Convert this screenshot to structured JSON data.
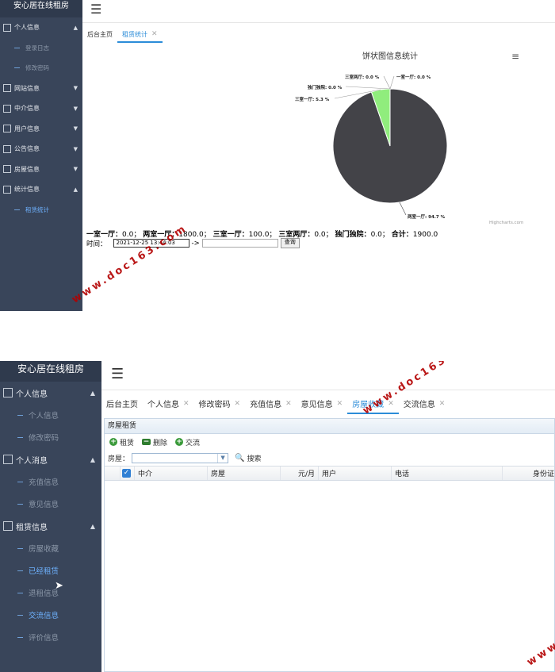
{
  "top": {
    "brand": "安心居在线租房",
    "menu": [
      {
        "label": "个人信息",
        "open": true,
        "subs": [
          {
            "label": "登录日志"
          },
          {
            "label": "修改密码"
          }
        ]
      },
      {
        "label": "网站信息"
      },
      {
        "label": "中介信息"
      },
      {
        "label": "用户信息"
      },
      {
        "label": "公告信息"
      },
      {
        "label": "房屋信息"
      },
      {
        "label": "统计信息",
        "open": true,
        "subs": [
          {
            "label": "租赁统计",
            "active": true
          }
        ]
      }
    ],
    "tabs": [
      {
        "label": "后台主页"
      },
      {
        "label": "租赁统计",
        "active": true
      }
    ],
    "summary": {
      "items": [
        {
          "label": "一室一厅：",
          "value": "0.0"
        },
        {
          "label": "两室一厅：",
          "value": "1800.0"
        },
        {
          "label": "三室一厅：",
          "value": "100.0"
        },
        {
          "label": "三室两厅：",
          "value": "0.0"
        },
        {
          "label": "独门独院：",
          "value": "0.0"
        }
      ],
      "total_label": "合计：",
      "total_value": "1900.0"
    },
    "time": {
      "label": "时间：",
      "start": "2021-12-25 13:44:03",
      "arrow": "->",
      "query_label": "查询"
    }
  },
  "chart_data": {
    "type": "pie",
    "title": "饼状图信息统计",
    "credits": "Highcharts.com",
    "slices": [
      {
        "name": "两室一厅",
        "value": 94.7,
        "label": "两室一厅: 94.7 %",
        "color": "#434348"
      },
      {
        "name": "三室一厅",
        "value": 5.3,
        "label": "三室一厅: 5.3 %",
        "color": "#90ed7d"
      },
      {
        "name": "独门独院",
        "value": 0.0,
        "label": "独门独院: 0.0 %",
        "color": "#f7a35c"
      },
      {
        "name": "三室两厅",
        "value": 0.0,
        "label": "三室两厅: 0.0 %",
        "color": "#8085e9"
      },
      {
        "name": "一室一厅",
        "value": 0.0,
        "label": "一室一厅: 0.0 %",
        "color": "#7cb5ec"
      }
    ]
  },
  "bottom": {
    "brand": "安心居在线租房",
    "menu": [
      {
        "label": "个人信息",
        "subs": [
          {
            "label": "个人信息"
          },
          {
            "label": "修改密码"
          }
        ]
      },
      {
        "label": "个人消息",
        "subs": [
          {
            "label": "充值信息"
          },
          {
            "label": "意见信息"
          }
        ]
      },
      {
        "label": "租赁信息",
        "subs": [
          {
            "label": "房屋收藏"
          },
          {
            "label": "已经租赁",
            "active": true
          },
          {
            "label": "退租信息"
          },
          {
            "label": "交流信息",
            "active": true
          },
          {
            "label": "评价信息"
          }
        ]
      }
    ],
    "tabs": [
      {
        "label": "后台主页"
      },
      {
        "label": "个人信息",
        "closable": true
      },
      {
        "label": "修改密码",
        "closable": true
      },
      {
        "label": "充值信息",
        "closable": true
      },
      {
        "label": "意见信息",
        "closable": true
      },
      {
        "label": "房屋收藏",
        "closable": true,
        "active": true
      },
      {
        "label": "交流信息",
        "closable": true
      }
    ],
    "panel_title": "房屋租赁",
    "toolbar": [
      {
        "label": "租赁",
        "icon": "plus-icon"
      },
      {
        "label": "删除",
        "icon": "minus-icon"
      },
      {
        "label": "交流",
        "icon": "plus-icon"
      }
    ],
    "filter_label": "房屋：",
    "search_label": "搜索",
    "columns": [
      "中介",
      "房屋",
      "元/月",
      "用户",
      "电话",
      "身份证"
    ]
  },
  "watermark": "www.doc163.com",
  "colors": {
    "sidebar": "#39455a",
    "accent": "#2b8cd8",
    "pie_main": "#434348",
    "pie_second": "#90ed7d"
  }
}
